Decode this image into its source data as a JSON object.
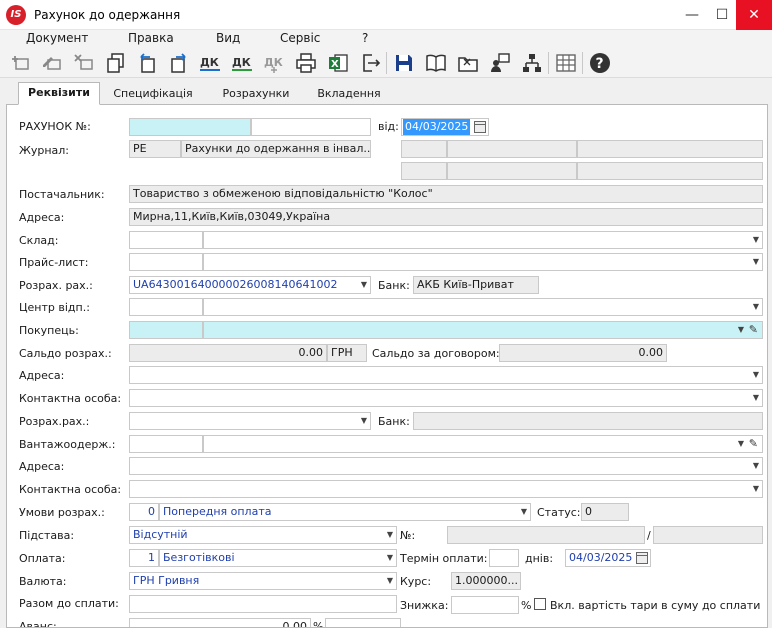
{
  "window": {
    "title": "Рахунок до одержання",
    "logo": "IS"
  },
  "menu": [
    "Документ",
    "Правка",
    "Вид",
    "Сервіс",
    "?"
  ],
  "toolbar_icons": [
    "add-row-icon",
    "edit-row-icon",
    "delete-row-icon",
    "copy-icon",
    "undo-icon",
    "redo-icon",
    "dk-icon",
    "dk-plus-icon",
    "dk-disabled-icon",
    "print-icon",
    "excel-icon",
    "exit-icon",
    "save-icon",
    "book-icon",
    "open-folder-icon",
    "users-icon",
    "tree-icon",
    "grid-icon",
    "help-icon"
  ],
  "tabs": [
    "Реквізити",
    "Специфікація",
    "Розрахунки",
    "Вкладення"
  ],
  "form": {
    "invoice_label": "РАХУНОК №:",
    "date_from_label": "від:",
    "date_value": "04/03/2025",
    "journal_label": "Журнал:",
    "journal_code": "PE",
    "journal_name": "Рахунки до одержання в інвал...",
    "supplier_label": "Постачальник:",
    "supplier_value": "Товариство з обмеженою відповідальністю \"Колос\"",
    "address_label": "Адреса:",
    "supplier_address": "Мирна,11,Київ,Київ,03049,Україна",
    "warehouse_label": "Склад:",
    "pricelist_label": "Прайс-лист:",
    "account_label": "Розрах. рах.:",
    "account_value": "UA643001640000026008140641002",
    "bank_label": "Банк:",
    "bank_value": "АКБ Київ-Приват",
    "center_label": "Центр відп.:",
    "buyer_label": "Покупець:",
    "saldo_label": "Сальдо розрах.:",
    "saldo_value": "0.00",
    "saldo_currency": "ГРН",
    "saldo_contract_label": "Сальдо за договором:",
    "saldo_contract_value": "0.00",
    "buyer_address_label": "Адреса:",
    "contact_label": "Контактна особа:",
    "buyer_account_label": "Розрах.рах.:",
    "buyer_bank_label": "Банк:",
    "consignee_label": "Вантажоодерж.:",
    "consignee_address_label": "Адреса:",
    "consignee_contact_label": "Контактна особа:",
    "terms_label": "Умови розрах.:",
    "terms_code": "0",
    "terms_value": "Попередня оплата",
    "status_label": "Статус:",
    "status_value": "0",
    "basis_label": "Підстава:",
    "basis_value": "Відсутній",
    "number_label": "№:",
    "slash": "/",
    "payment_label": "Оплата:",
    "payment_code": "1",
    "payment_value": "Безготівкові",
    "pay_term_label": "Термін оплати:",
    "days_label": "днів:",
    "pay_date": "04/03/2025",
    "currency_label": "Валюта:",
    "currency_value": "ГРН Гривня",
    "rate_label": "Курс:",
    "rate_value": "1.000000...",
    "total_label": "Разом до сплати:",
    "discount_label": "Знижка:",
    "percent": "%",
    "tare_label": "Вкл. вартість тари в суму до сплати",
    "advance_label": "Аванс:",
    "advance_value": "0.00",
    "advance_percent": "%"
  }
}
